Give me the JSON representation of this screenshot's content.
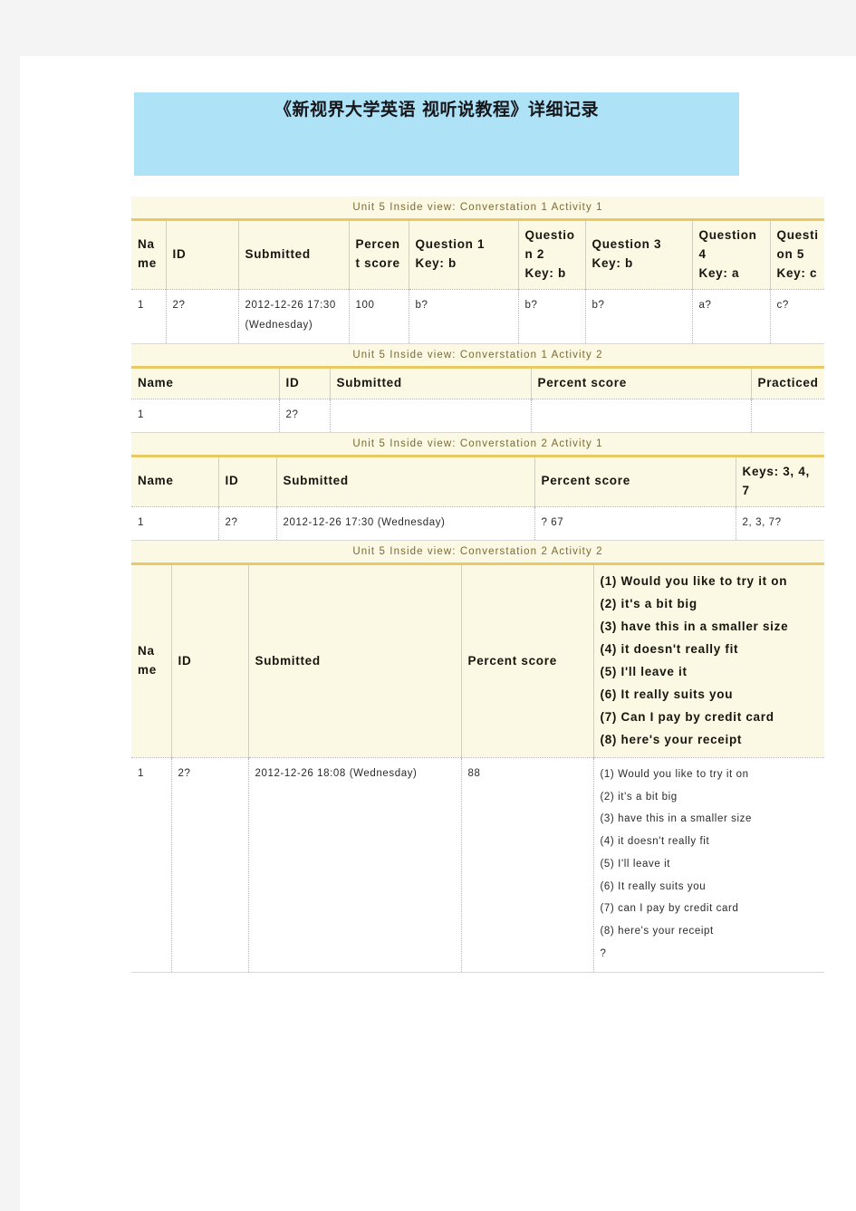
{
  "document": {
    "title": "《新视界大学英语 视听说教程》详细记录"
  },
  "tables": [
    {
      "caption": "Unit 5 Inside view: Converstation 1 Activity 1",
      "headers": [
        "Name",
        "ID",
        "Submitted",
        "Percent score",
        "Question 1\nKey: b",
        "Question 2\nKey: b",
        "Question 3\nKey: b",
        "Question 4\nKey: a",
        "Question 5\nKey: c"
      ],
      "header_lines": [
        [
          "Name"
        ],
        [
          "ID"
        ],
        [
          "Submitted"
        ],
        [
          "Percent score"
        ],
        [
          "Question 1",
          "Key: b"
        ],
        [
          "Question 2",
          "Key: b"
        ],
        [
          "Question 3",
          "Key: b"
        ],
        [
          "Question 4",
          "Key: a"
        ],
        [
          "Question 5",
          "Key: c"
        ]
      ],
      "rows": [
        {
          "name": "1",
          "id": "2?",
          "submitted": "2012-12-26 17:30 (Wednesday)",
          "percent_score": "100",
          "q1": "b?",
          "q2": "b?",
          "q3": "b?",
          "q4": "a?",
          "q5": "c?"
        }
      ]
    },
    {
      "caption": "Unit 5 Inside view: Converstation 1 Activity 2",
      "headers": [
        "Name",
        "ID",
        "Submitted",
        "Percent score",
        "Practiced"
      ],
      "rows": [
        {
          "name": "1",
          "id": "2?",
          "submitted": "",
          "percent_score": "",
          "practiced": ""
        }
      ]
    },
    {
      "caption": "Unit 5 Inside view: Converstation 2 Activity 1",
      "headers": [
        "Name",
        "ID",
        "Submitted",
        "Percent score",
        "Keys: 3, 4, 7"
      ],
      "rows": [
        {
          "name": "1",
          "id": "2?",
          "submitted": "2012-12-26 17:30 (Wednesday)",
          "percent_score": "? 67",
          "keys": "2, 3, 7?"
        }
      ]
    },
    {
      "caption": "Unit 5 Inside view: Converstation 2 Activity 2",
      "headers": [
        "Name",
        "ID",
        "Submitted",
        "Percent score"
      ],
      "question_header_lines": [
        "(1) Would you like to try it on",
        "(2) it's a bit big",
        "(3) have this in a smaller size",
        "(4) it doesn't really fit",
        "(5) I'll leave it",
        "(6) It really suits you",
        "(7) Can I pay by credit card",
        "(8) here's your receipt"
      ],
      "rows": [
        {
          "name": "1",
          "id": "2?",
          "submitted": "2012-12-26 18:08 (Wednesday)",
          "percent_score": "88",
          "answer_lines": [
            "(1) Would you like to try it on",
            "(2) it's a bit big",
            "(3) have this in a smaller size",
            "(4) it doesn't really fit",
            "(5) I'll leave it",
            "(6) It really suits you",
            "(7) can I pay by credit card",
            "(8) here's your receipt",
            "?"
          ]
        }
      ]
    }
  ],
  "colors": {
    "banner": "#ade2f7",
    "table_top_border": "#e9c964",
    "header_bg": "#fbf8e3",
    "caption_text": "#7c6a31",
    "page_bg": "#ffffff",
    "margin_bg": "#f4f4f4"
  }
}
